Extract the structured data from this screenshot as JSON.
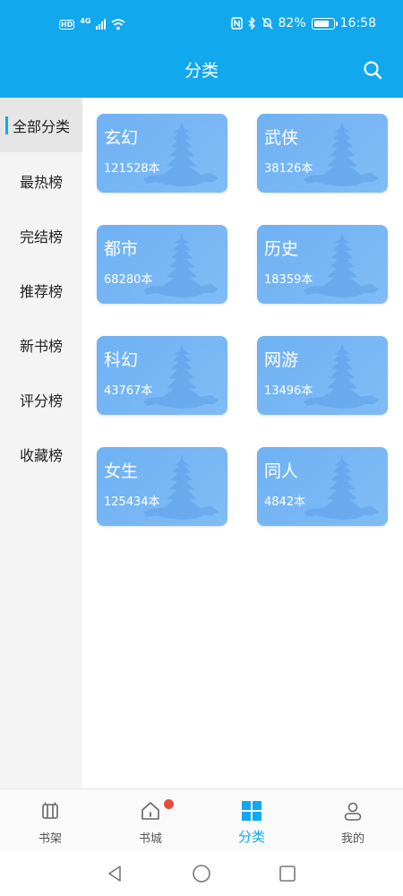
{
  "status_bar": {
    "network": "4G",
    "battery_percent": "82%",
    "time": "16:58"
  },
  "header": {
    "title": "分类",
    "search_icon": "search-icon"
  },
  "sidebar": {
    "items": [
      {
        "label": "全部分类",
        "active": true
      },
      {
        "label": "最热榜",
        "active": false
      },
      {
        "label": "完结榜",
        "active": false
      },
      {
        "label": "推荐榜",
        "active": false
      },
      {
        "label": "新书榜",
        "active": false
      },
      {
        "label": "评分榜",
        "active": false
      },
      {
        "label": "收藏榜",
        "active": false
      }
    ]
  },
  "categories": [
    {
      "name": "玄幻",
      "count": "121528本"
    },
    {
      "name": "武侠",
      "count": "38126本"
    },
    {
      "name": "都市",
      "count": "68280本"
    },
    {
      "name": "历史",
      "count": "18359本"
    },
    {
      "name": "科幻",
      "count": "43767本"
    },
    {
      "name": "网游",
      "count": "13496本"
    },
    {
      "name": "女生",
      "count": "125434本"
    },
    {
      "name": "同人",
      "count": "4842本"
    }
  ],
  "bottom_nav": {
    "items": [
      {
        "label": "书架",
        "icon": "bookshelf-icon",
        "active": false
      },
      {
        "label": "书城",
        "icon": "home-icon",
        "active": false,
        "badge": true
      },
      {
        "label": "分类",
        "icon": "grid-icon",
        "active": true
      },
      {
        "label": "我的",
        "icon": "user-icon",
        "active": false
      }
    ]
  },
  "colors": {
    "primary": "#11a8ee",
    "card": "#74b5f4",
    "badge": "#e84b3c",
    "sidebar_bg": "#f4f4f4"
  }
}
